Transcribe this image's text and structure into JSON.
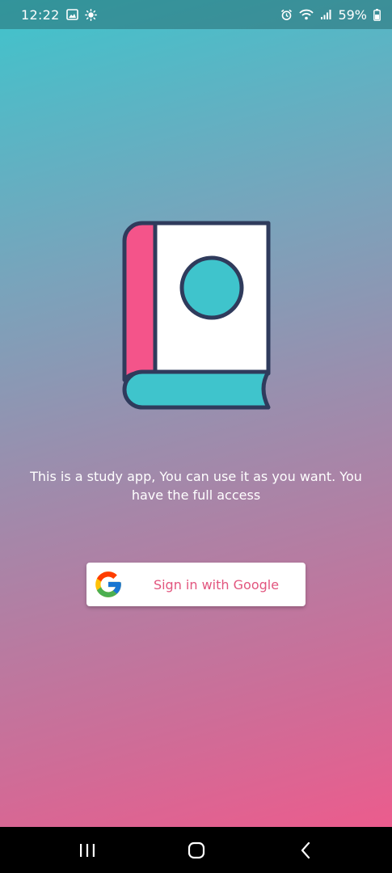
{
  "status_bar": {
    "time": "12:22",
    "battery_percent": "59%",
    "left_icons": [
      "image-icon",
      "brightness-icon"
    ],
    "right_icons": [
      "alarm-icon",
      "wifi-icon",
      "signal-icon",
      "battery-icon"
    ]
  },
  "hero": {
    "icon": "book-icon",
    "colors": {
      "outline": "#2f3b5c",
      "spine": "#f4548a",
      "page": "#ffffff",
      "cover_base": "#3fc4cc",
      "circle": "#3fc4cc"
    }
  },
  "description": "This is a study app, You can use it as you want. You have the full access",
  "sign_in": {
    "label": "Sign in with Google",
    "icon": "google-icon",
    "label_color": "#e2557e"
  },
  "nav_bar": {
    "items": [
      "recent-apps-icon",
      "home-icon",
      "back-icon"
    ]
  }
}
